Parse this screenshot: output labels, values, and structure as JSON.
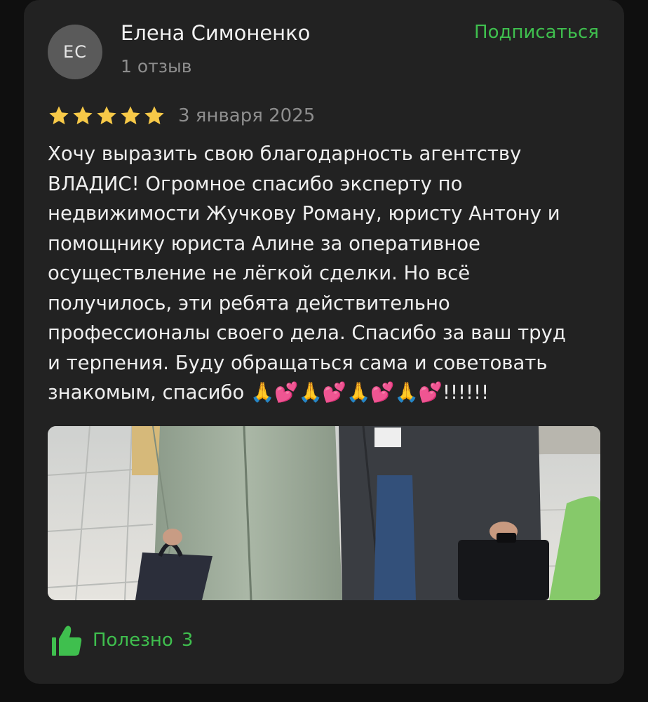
{
  "review": {
    "author": {
      "initials": "ЕС",
      "name": "Елена Симоненко",
      "reviews_count_text": "1 отзыв"
    },
    "subscribe_label": "Подписаться",
    "rating": 5,
    "rating_max": 5,
    "date": "3 января 2025",
    "text": "Хочу выразить свою благодарность агентству\nВЛАДИС! Огромное спасибо эксперту по\nнедвижимости Жучкову Роману, юристу Антону и\nпомощнику юриста Алине за оперативное\nосуществление не лёгкой сделки. Но всё\nполучилось, эти ребята действительно\nпрофессионалы своего дела. Спасибо за ваш труд\nи терпения. Буду обращаться сама и советовать\nзнакомым, спасибо 🙏💕🙏💕🙏💕🙏💕!!!!!!",
    "helpful": {
      "label": "Полезно",
      "count": "3"
    }
  },
  "icons": {
    "star": "star-icon",
    "thumb": "thumbs-up-icon"
  },
  "colors": {
    "background": "#0f0f0f",
    "card": "#222222",
    "accent_green": "#3fbf4e",
    "star": "#f7c948",
    "muted_text": "#8e8e8e"
  }
}
